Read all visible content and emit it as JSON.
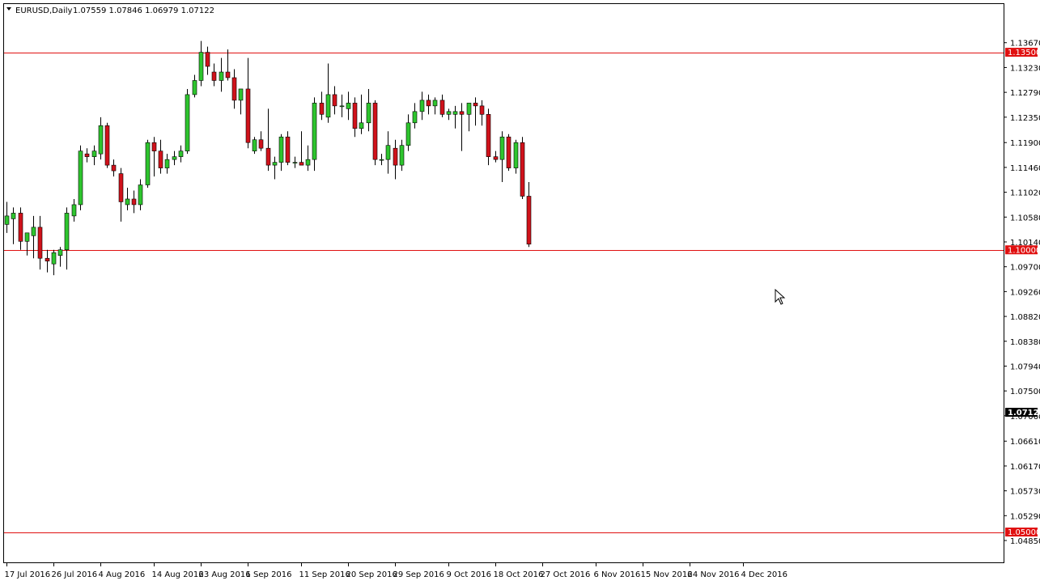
{
  "header": {
    "symbol": "EURUSD,Daily",
    "ohlc": "1.07559 1.07846 1.06979 1.07122"
  },
  "colors": {
    "bull": "#2ec52e",
    "bear": "#d0121b",
    "level_line": "#e01010",
    "axis": "#000000",
    "current_tag": "#000000"
  },
  "chart_data": {
    "type": "candlestick",
    "ylim": [
      1.0485,
      1.1391
    ],
    "y_ticks": [
      "1.13670",
      "1.13230",
      "1.12790",
      "1.12350",
      "1.11900",
      "1.11460",
      "1.11020",
      "1.10580",
      "1.10140",
      "1.09700",
      "1.09260",
      "1.08820",
      "1.08380",
      "1.07940",
      "1.07500",
      "1.07060",
      "1.06610",
      "1.06170",
      "1.05730",
      "1.05290",
      "1.04850"
    ],
    "x_ticks": [
      {
        "label": "17 Jul 2016",
        "index": 0
      },
      {
        "label": "26 Jul 2016",
        "index": 7
      },
      {
        "label": "4 Aug 2016",
        "index": 14
      },
      {
        "label": "14 Aug 2016",
        "index": 22
      },
      {
        "label": "23 Aug 2016",
        "index": 29
      },
      {
        "label": "1 Sep 2016",
        "index": 36
      },
      {
        "label": "11 Sep 2016",
        "index": 44
      },
      {
        "label": "20 Sep 2016",
        "index": 51
      },
      {
        "label": "29 Sep 2016",
        "index": 58
      },
      {
        "label": "9 Oct 2016",
        "index": 66
      },
      {
        "label": "18 Oct 2016",
        "index": 73
      },
      {
        "label": "27 Oct 2016",
        "index": 80
      },
      {
        "label": "6 Nov 2016",
        "index": 88
      },
      {
        "label": "15 Nov 2016",
        "index": 95
      },
      {
        "label": "24 Nov 2016",
        "index": 102
      },
      {
        "label": "4 Dec 2016",
        "index": 110
      }
    ],
    "horizontal_lines": [
      {
        "value": 1.135,
        "label": "1.13500"
      },
      {
        "value": 1.1,
        "label": "1.10000"
      },
      {
        "value": 1.05,
        "label": "1.05000"
      }
    ],
    "current_price": {
      "value": 1.07122,
      "label": "1.07122"
    },
    "candles": [
      {
        "o": 1.1045,
        "h": 1.1085,
        "l": 1.103,
        "c": 1.106
      },
      {
        "o": 1.1055,
        "h": 1.1075,
        "l": 1.101,
        "c": 1.1065
      },
      {
        "o": 1.1065,
        "h": 1.1075,
        "l": 1.1,
        "c": 1.1015
      },
      {
        "o": 1.1015,
        "h": 1.103,
        "l": 1.099,
        "c": 1.103
      },
      {
        "o": 1.1025,
        "h": 1.106,
        "l": 1.0985,
        "c": 1.104
      },
      {
        "o": 1.104,
        "h": 1.106,
        "l": 1.0965,
        "c": 1.0985
      },
      {
        "o": 1.0985,
        "h": 1.1,
        "l": 1.096,
        "c": 1.098
      },
      {
        "o": 1.0975,
        "h": 1.1,
        "l": 1.0955,
        "c": 1.0995
      },
      {
        "o": 1.099,
        "h": 1.1005,
        "l": 1.097,
        "c": 1.1
      },
      {
        "o": 1.1,
        "h": 1.1075,
        "l": 1.0965,
        "c": 1.1065
      },
      {
        "o": 1.106,
        "h": 1.109,
        "l": 1.105,
        "c": 1.108
      },
      {
        "o": 1.108,
        "h": 1.1185,
        "l": 1.107,
        "c": 1.1175
      },
      {
        "o": 1.117,
        "h": 1.118,
        "l": 1.1155,
        "c": 1.1165
      },
      {
        "o": 1.1165,
        "h": 1.1185,
        "l": 1.115,
        "c": 1.1175
      },
      {
        "o": 1.117,
        "h": 1.1235,
        "l": 1.116,
        "c": 1.122
      },
      {
        "o": 1.122,
        "h": 1.1225,
        "l": 1.1145,
        "c": 1.115
      },
      {
        "o": 1.115,
        "h": 1.116,
        "l": 1.113,
        "c": 1.114
      },
      {
        "o": 1.1135,
        "h": 1.1145,
        "l": 1.105,
        "c": 1.1085
      },
      {
        "o": 1.108,
        "h": 1.111,
        "l": 1.107,
        "c": 1.109
      },
      {
        "o": 1.109,
        "h": 1.1105,
        "l": 1.1065,
        "c": 1.108
      },
      {
        "o": 1.108,
        "h": 1.1125,
        "l": 1.107,
        "c": 1.1115
      },
      {
        "o": 1.1115,
        "h": 1.1195,
        "l": 1.111,
        "c": 1.119
      },
      {
        "o": 1.119,
        "h": 1.12,
        "l": 1.113,
        "c": 1.1175
      },
      {
        "o": 1.1175,
        "h": 1.1195,
        "l": 1.1135,
        "c": 1.1145
      },
      {
        "o": 1.1145,
        "h": 1.117,
        "l": 1.1135,
        "c": 1.116
      },
      {
        "o": 1.116,
        "h": 1.1175,
        "l": 1.115,
        "c": 1.1165
      },
      {
        "o": 1.1165,
        "h": 1.1185,
        "l": 1.1155,
        "c": 1.1175
      },
      {
        "o": 1.1175,
        "h": 1.1285,
        "l": 1.117,
        "c": 1.1275
      },
      {
        "o": 1.1275,
        "h": 1.131,
        "l": 1.127,
        "c": 1.13
      },
      {
        "o": 1.13,
        "h": 1.137,
        "l": 1.129,
        "c": 1.135
      },
      {
        "o": 1.135,
        "h": 1.136,
        "l": 1.131,
        "c": 1.1325
      },
      {
        "o": 1.1315,
        "h": 1.133,
        "l": 1.129,
        "c": 1.13
      },
      {
        "o": 1.13,
        "h": 1.134,
        "l": 1.128,
        "c": 1.1315
      },
      {
        "o": 1.1315,
        "h": 1.1355,
        "l": 1.13,
        "c": 1.1305
      },
      {
        "o": 1.1305,
        "h": 1.132,
        "l": 1.125,
        "c": 1.1265
      },
      {
        "o": 1.1265,
        "h": 1.1285,
        "l": 1.124,
        "c": 1.1285
      },
      {
        "o": 1.1285,
        "h": 1.134,
        "l": 1.118,
        "c": 1.119
      },
      {
        "o": 1.1175,
        "h": 1.12,
        "l": 1.117,
        "c": 1.1195
      },
      {
        "o": 1.1195,
        "h": 1.121,
        "l": 1.1175,
        "c": 1.118
      },
      {
        "o": 1.118,
        "h": 1.125,
        "l": 1.114,
        "c": 1.115
      },
      {
        "o": 1.115,
        "h": 1.1165,
        "l": 1.1125,
        "c": 1.1155
      },
      {
        "o": 1.1155,
        "h": 1.1205,
        "l": 1.114,
        "c": 1.12
      },
      {
        "o": 1.12,
        "h": 1.121,
        "l": 1.115,
        "c": 1.1155
      },
      {
        "o": 1.1155,
        "h": 1.1165,
        "l": 1.1145,
        "c": 1.1155
      },
      {
        "o": 1.1155,
        "h": 1.121,
        "l": 1.115,
        "c": 1.115
      },
      {
        "o": 1.115,
        "h": 1.1185,
        "l": 1.114,
        "c": 1.116
      },
      {
        "o": 1.116,
        "h": 1.127,
        "l": 1.114,
        "c": 1.126
      },
      {
        "o": 1.126,
        "h": 1.128,
        "l": 1.123,
        "c": 1.124
      },
      {
        "o": 1.1235,
        "h": 1.133,
        "l": 1.1225,
        "c": 1.1275
      },
      {
        "o": 1.1275,
        "h": 1.129,
        "l": 1.124,
        "c": 1.1255
      },
      {
        "o": 1.1255,
        "h": 1.1275,
        "l": 1.1235,
        "c": 1.1255
      },
      {
        "o": 1.125,
        "h": 1.128,
        "l": 1.123,
        "c": 1.126
      },
      {
        "o": 1.126,
        "h": 1.127,
        "l": 1.12,
        "c": 1.1215
      },
      {
        "o": 1.1215,
        "h": 1.1275,
        "l": 1.1205,
        "c": 1.1225
      },
      {
        "o": 1.1225,
        "h": 1.1285,
        "l": 1.121,
        "c": 1.126
      },
      {
        "o": 1.126,
        "h": 1.1265,
        "l": 1.115,
        "c": 1.116
      },
      {
        "o": 1.116,
        "h": 1.117,
        "l": 1.115,
        "c": 1.116
      },
      {
        "o": 1.116,
        "h": 1.121,
        "l": 1.1135,
        "c": 1.1185
      },
      {
        "o": 1.118,
        "h": 1.1195,
        "l": 1.1125,
        "c": 1.115
      },
      {
        "o": 1.115,
        "h": 1.1195,
        "l": 1.114,
        "c": 1.1185
      },
      {
        "o": 1.1185,
        "h": 1.124,
        "l": 1.1175,
        "c": 1.1225
      },
      {
        "o": 1.1225,
        "h": 1.126,
        "l": 1.1215,
        "c": 1.1245
      },
      {
        "o": 1.1245,
        "h": 1.128,
        "l": 1.123,
        "c": 1.1265
      },
      {
        "o": 1.1265,
        "h": 1.1275,
        "l": 1.124,
        "c": 1.1255
      },
      {
        "o": 1.1255,
        "h": 1.127,
        "l": 1.124,
        "c": 1.1265
      },
      {
        "o": 1.1265,
        "h": 1.1275,
        "l": 1.1235,
        "c": 1.124
      },
      {
        "o": 1.124,
        "h": 1.125,
        "l": 1.123,
        "c": 1.1245
      },
      {
        "o": 1.124,
        "h": 1.1255,
        "l": 1.1215,
        "c": 1.1245
      },
      {
        "o": 1.1245,
        "h": 1.126,
        "l": 1.1175,
        "c": 1.124
      },
      {
        "o": 1.124,
        "h": 1.126,
        "l": 1.121,
        "c": 1.126
      },
      {
        "o": 1.126,
        "h": 1.127,
        "l": 1.122,
        "c": 1.1255
      },
      {
        "o": 1.1255,
        "h": 1.1265,
        "l": 1.122,
        "c": 1.124
      },
      {
        "o": 1.124,
        "h": 1.125,
        "l": 1.115,
        "c": 1.1165
      },
      {
        "o": 1.1165,
        "h": 1.1175,
        "l": 1.1155,
        "c": 1.116
      },
      {
        "o": 1.116,
        "h": 1.121,
        "l": 1.112,
        "c": 1.12
      },
      {
        "o": 1.12,
        "h": 1.1205,
        "l": 1.114,
        "c": 1.1145
      },
      {
        "o": 1.1145,
        "h": 1.1195,
        "l": 1.1135,
        "c": 1.119
      },
      {
        "o": 1.119,
        "h": 1.12,
        "l": 1.109,
        "c": 1.1095
      },
      {
        "o": 1.1095,
        "h": 1.112,
        "l": 1.1005,
        "c": 1.101
      }
    ]
  }
}
